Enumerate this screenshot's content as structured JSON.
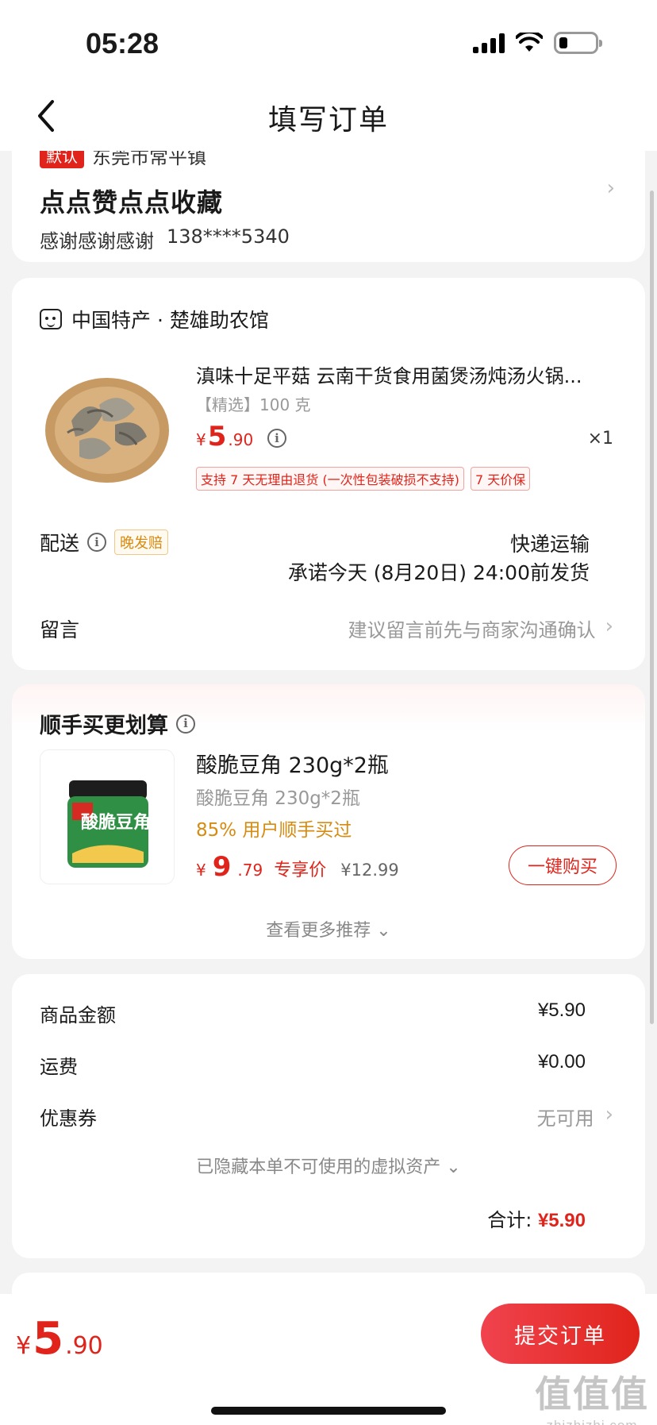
{
  "status_bar": {
    "time": "05:28",
    "icons": [
      "signal-icon",
      "wifi-icon",
      "battery-icon"
    ]
  },
  "header": {
    "title": "填写订单",
    "back_icon": "chevron-left-icon"
  },
  "address": {
    "default_tag": "默认",
    "region_partial": "东莞市常平镇",
    "recipient_name": "点点赞点点收藏",
    "contact_name": "感谢感谢感谢",
    "phone": "138****5340"
  },
  "shop": {
    "name": "中国特产 · 楚雄助农馆",
    "product": {
      "title": "滇味十足平菇 云南干货食用菌煲汤炖汤火锅...",
      "spec": "【精选】100 克",
      "price_symbol": "¥",
      "price_int": "5",
      "price_dec": ".90",
      "quantity": "×1",
      "badges": [
        "支持 7 天无理由退货 (一次性包装破损不支持)",
        "7 天价保"
      ]
    },
    "delivery": {
      "label": "配送",
      "tag": "晚发赔",
      "method": "快递运输",
      "promise": "承诺今天 (8月20日) 24:00前发货"
    },
    "message": {
      "label": "留言",
      "hint": "建议留言前先与商家沟通确认"
    }
  },
  "recommend": {
    "title": "顺手买更划算",
    "item": {
      "name": "酸脆豆角 230g*2瓶",
      "subtitle": "酸脆豆角 230g*2瓶",
      "bought": "85% 用户顺手买过",
      "price_symbol": "¥",
      "price_int": "9",
      "price_dec": ".79",
      "exclusive_label": "专享价",
      "original_price": "¥12.99",
      "buy_button": "一键购买",
      "jar_label": "酸脆豆角"
    },
    "more_label": "查看更多推荐"
  },
  "summary": {
    "goods_label": "商品金额",
    "goods_value": "¥5.90",
    "shipping_label": "运费",
    "shipping_value": "¥0.00",
    "coupon_label": "优惠券",
    "coupon_value": "无可用",
    "hidden_assets": "已隐藏本单不可使用的虚拟资产",
    "total_label": "合计:",
    "total_value": "¥5.90"
  },
  "bottom_bar": {
    "price_symbol": "¥",
    "price_int": "5",
    "price_dec": ".90",
    "submit_label": "提交订单"
  },
  "watermark": {
    "big": "值值值",
    "small": "zhizhizhi.com"
  },
  "colors": {
    "accent": "#e0241b",
    "orange": "#d68b12",
    "muted": "#999999",
    "background": "#f3f3f3"
  }
}
